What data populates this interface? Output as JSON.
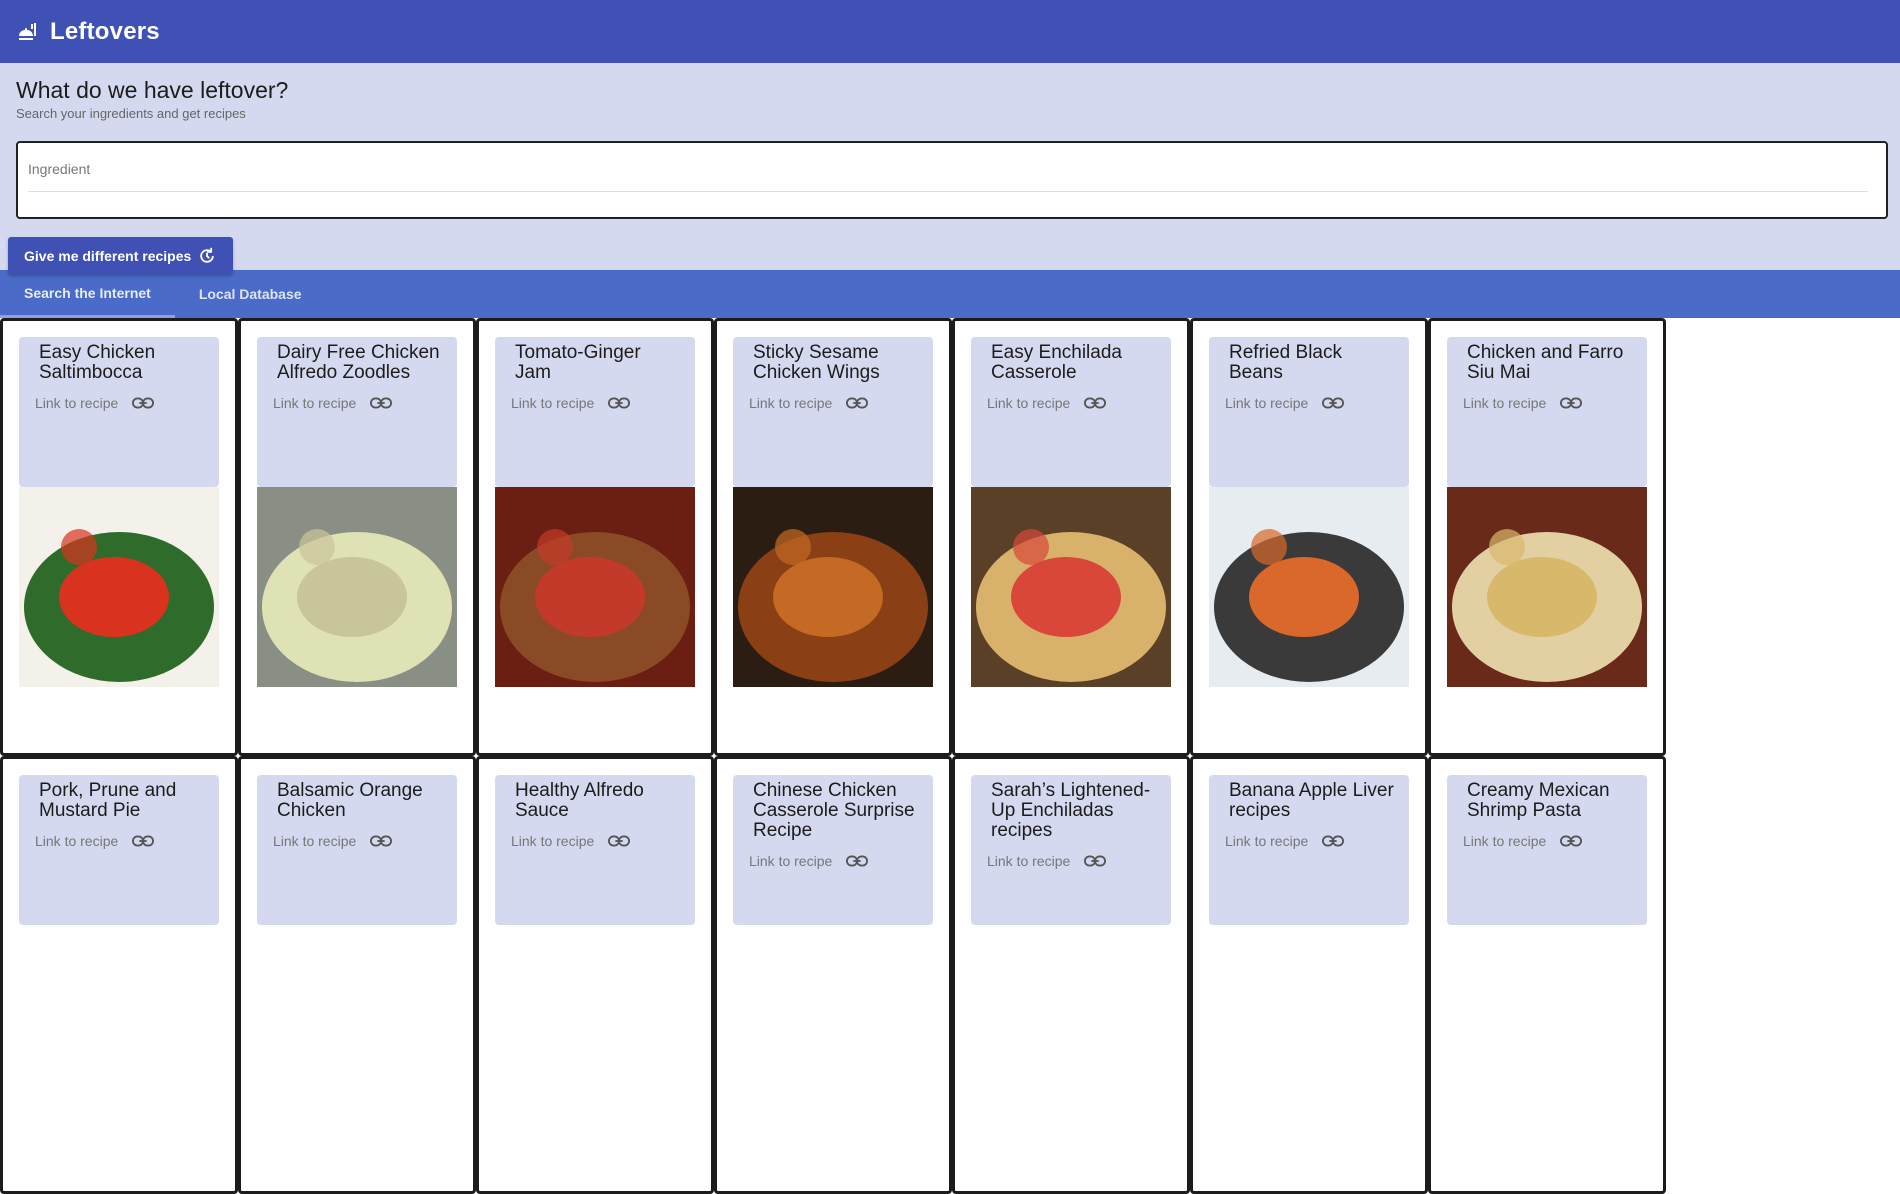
{
  "app": {
    "title": "Leftovers"
  },
  "hero": {
    "heading": "What do we have leftover?",
    "subtitle": "Search your ingredients and get recipes",
    "ingredient_placeholder": "Ingredient",
    "button_label": "Give me different recipes"
  },
  "tabs": [
    {
      "label": "Search the Internet",
      "active": true
    },
    {
      "label": "Local Database",
      "active": false
    }
  ],
  "link_label": "Link to recipe",
  "recipes": [
    {
      "name": "Easy Chicken Saltimbocca"
    },
    {
      "name": "Dairy Free Chicken Alfredo Zoodles"
    },
    {
      "name": "Tomato-Ginger Jam"
    },
    {
      "name": "Sticky Sesame Chicken Wings"
    },
    {
      "name": "Easy Enchilada Casserole"
    },
    {
      "name": "Refried Black Beans"
    },
    {
      "name": "Chicken and Farro Siu Mai"
    },
    {
      "name": "Pork, Prune and Mustard Pie"
    },
    {
      "name": "Balsamic Orange Chicken"
    },
    {
      "name": "Healthy Alfredo Sauce"
    },
    {
      "name": "Chinese Chicken Casserole Surprise Recipe"
    },
    {
      "name": "Sarah’s Lightened-Up Enchiladas recipes"
    },
    {
      "name": "Banana Apple Liver recipes"
    },
    {
      "name": "Creamy Mexican Shrimp Pasta"
    }
  ],
  "colors": {
    "primary": "#3f51b5",
    "tabs": "#4a6bc8",
    "surface": "#d4d9ef"
  }
}
